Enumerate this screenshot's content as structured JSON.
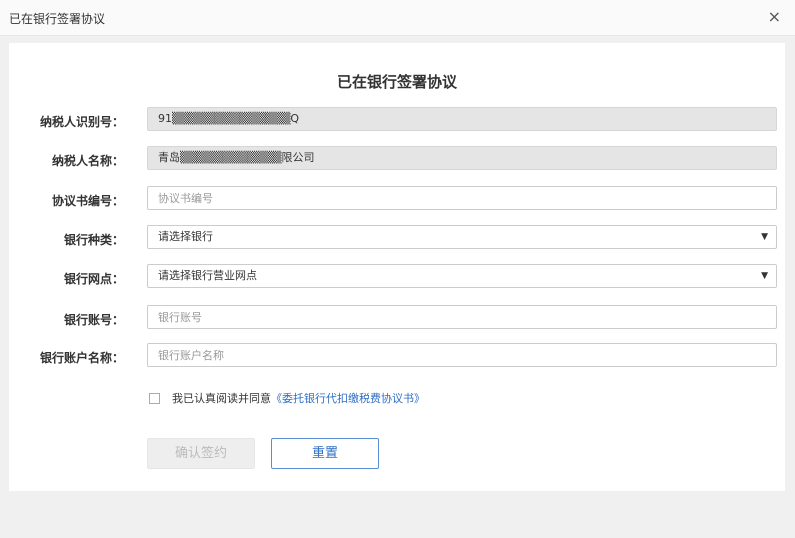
{
  "window": {
    "title": "已在银行签署协议",
    "close_symbol": "×"
  },
  "form": {
    "title": "已在银行签署协议",
    "fields": {
      "tax_id": {
        "label": "纳税人识别号：",
        "value": "91▒▒▒▒▒▒▒▒▒▒▒▒▒▒Q"
      },
      "taxpayer_name": {
        "label": "纳税人名称：",
        "value": "青岛▒▒▒▒▒▒▒▒▒▒▒▒限公司"
      },
      "agreement_no": {
        "label": "协议书编号：",
        "placeholder": "协议书编号"
      },
      "bank_type": {
        "label": "银行种类：",
        "selected": "请选择银行"
      },
      "bank_branch": {
        "label": "银行网点：",
        "selected": "请选择银行营业网点"
      },
      "bank_account": {
        "label": "银行账号：",
        "placeholder": "银行账号"
      },
      "account_name": {
        "label": "银行账户名称：",
        "placeholder": "银行账户名称"
      }
    },
    "agreement": {
      "text": "我已认真阅读并同意",
      "link": "《委托银行代扣缴税费协议书》"
    },
    "buttons": {
      "confirm": "确认签约",
      "reset": "重置"
    }
  },
  "colors": {
    "link": "#2f6fc4",
    "readonly_bg": "#e5e5e5",
    "page_bg": "#f0f0f0"
  }
}
